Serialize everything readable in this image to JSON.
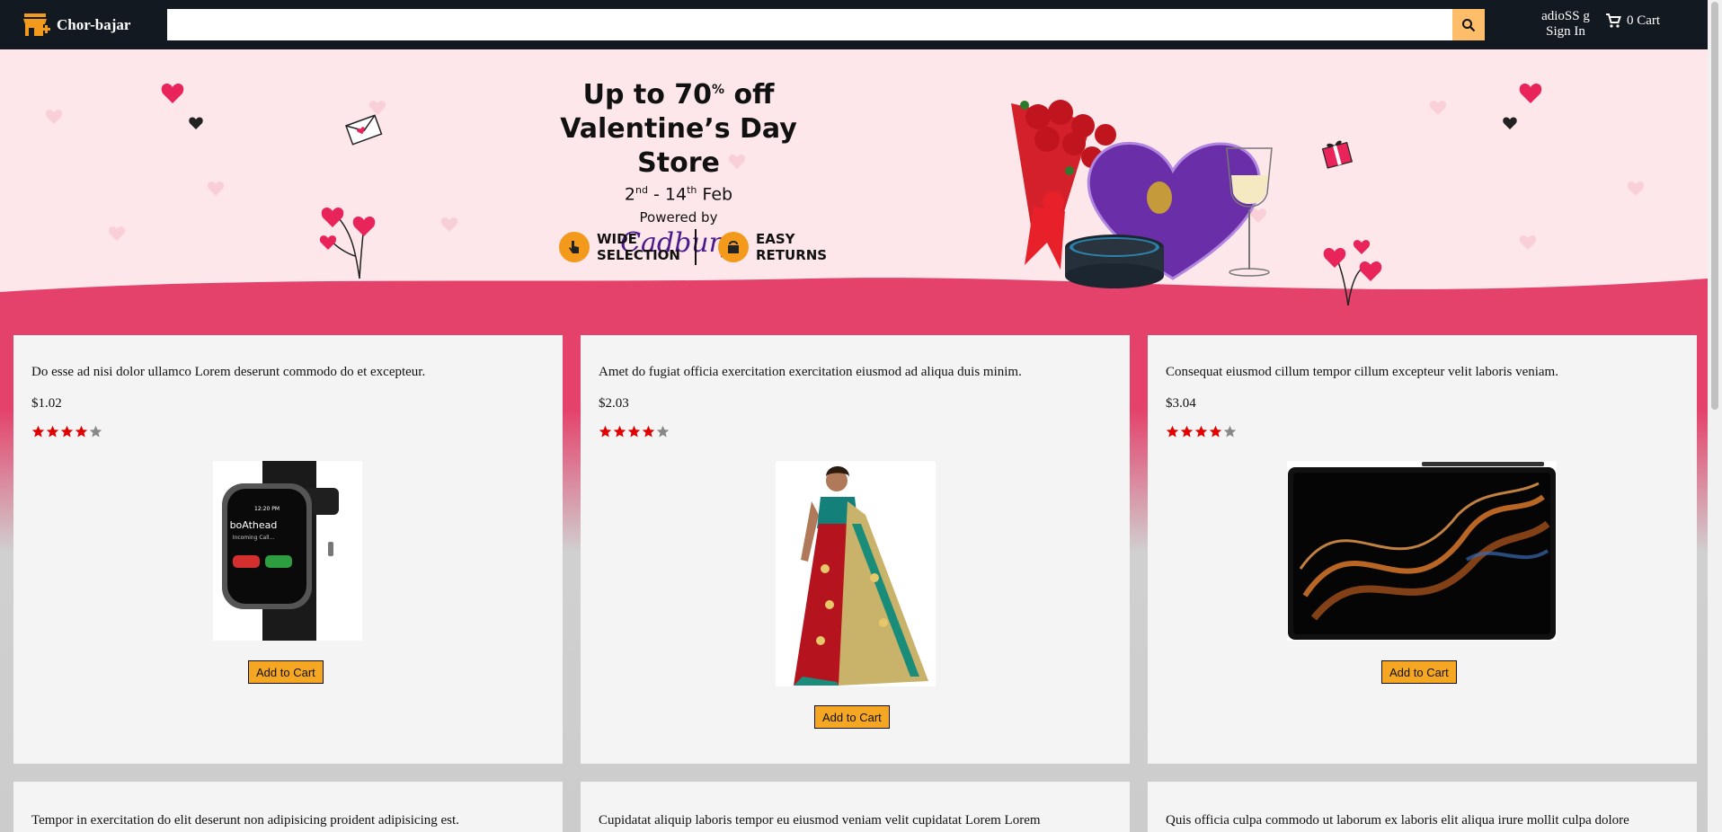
{
  "header": {
    "logo_text": "Chor-bajar",
    "search_placeholder": "",
    "account_name": "adioSS g",
    "sign_in": "Sign In",
    "cart_label": "0 Cart"
  },
  "banner": {
    "title_prefix": "Up to 70",
    "title_sup": "%",
    "title_suffix": " off",
    "subtitle": "Valentine’s Day Store",
    "date_start": "2",
    "date_start_sup": "nd",
    "date_mid": " - 14",
    "date_end_sup": "th",
    "date_end": " Feb",
    "powered_by": "Powered by",
    "brand": "Cadbury",
    "feature1": [
      "WIDE",
      "SELECTION"
    ],
    "feature2": [
      "EASY",
      "RETURNS"
    ]
  },
  "products": [
    {
      "title": "Do esse ad nisi dolor ullamco Lorem deserunt commodo do et excepteur.",
      "price": "$1.02",
      "rating": 4,
      "image": "smartwatch",
      "button": "Add to Cart"
    },
    {
      "title": "Amet do fugiat officia exercitation exercitation eiusmod ad aliqua duis minim.",
      "price": "$2.03",
      "rating": 4,
      "image": "saree",
      "button": "Add to Cart"
    },
    {
      "title": "Consequat eiusmod cillum tempor cillum excepteur velit laboris veniam.",
      "price": "$3.04",
      "rating": 4,
      "image": "tablet",
      "button": "Add to Cart"
    },
    {
      "title": "Tempor in exercitation do elit deserunt non adipisicing proident adipisicing est."
    },
    {
      "title": "Cupidatat aliquip laboris tempor eu eiusmod veniam velit cupidatat Lorem Lorem"
    },
    {
      "title": "Quis officia culpa commodo ut laborum ex laboris elit aliqua irure mollit culpa dolore"
    }
  ],
  "colors": {
    "header_bg": "#131921",
    "search_button": "#febd69",
    "add_button": "#f5a623",
    "star_filled": "#e00000",
    "star_empty": "#888888",
    "banner_bg": "#fde7ea",
    "banner_wave": "#e4416b"
  }
}
